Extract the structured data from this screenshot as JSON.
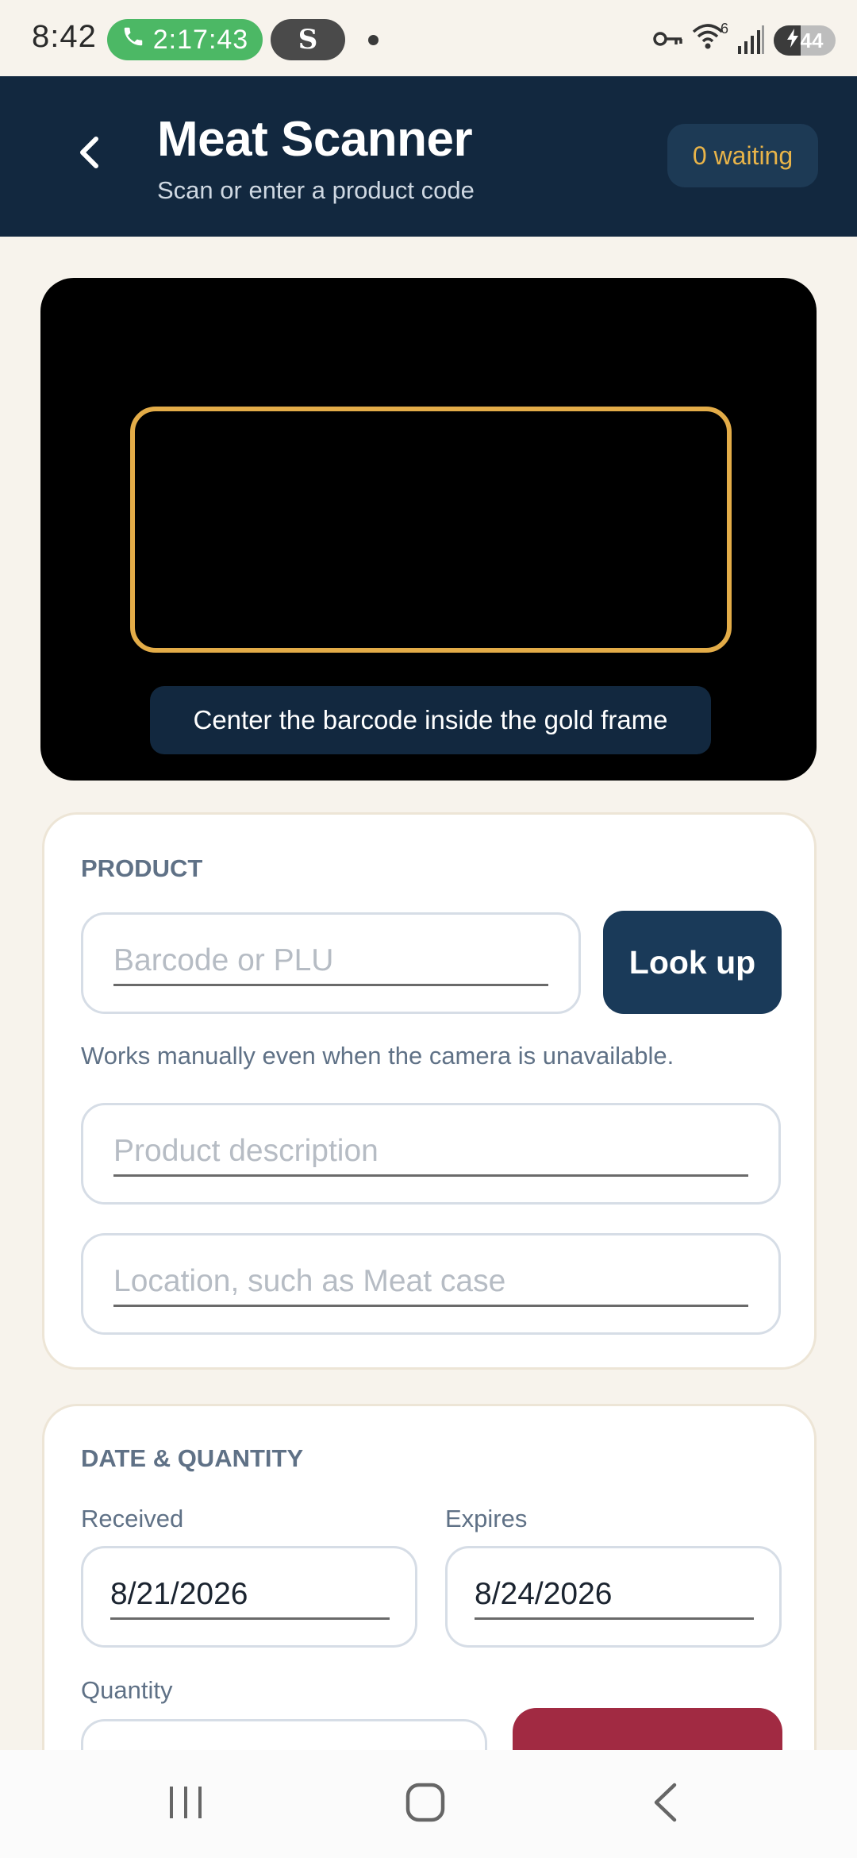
{
  "status_bar": {
    "time": "8:42",
    "call_timer": "2:17:43",
    "app_badge": "S",
    "wifi_label": "6",
    "battery_level": "44",
    "icons": [
      "phone-icon",
      "vpn-key-icon",
      "wifi-icon",
      "signal-icon",
      "battery-charging-icon"
    ]
  },
  "header": {
    "title": "Meat Scanner",
    "subtitle": "Scan or enter a product code",
    "waiting_badge": "0 waiting",
    "back_icon": "chevron-left-icon"
  },
  "camera": {
    "hint": "Center the barcode inside the gold frame"
  },
  "product": {
    "section_label": "PRODUCT",
    "barcode_placeholder": "Barcode or PLU",
    "barcode_value": "",
    "lookup_label": "Look up",
    "helper": "Works manually even when the camera is unavailable.",
    "description_placeholder": "Product description",
    "description_value": "",
    "location_placeholder": "Location, such as Meat case",
    "location_value": ""
  },
  "date_quantity": {
    "section_label": "DATE & QUANTITY",
    "received_label": "Received",
    "received_value": "8/21/2026",
    "expires_label": "Expires",
    "expires_value": "8/24/2026",
    "quantity_label": "Quantity",
    "quantity_value": ""
  },
  "nav": {
    "icons": [
      "recents-icon",
      "home-icon",
      "back-icon"
    ]
  },
  "colors": {
    "header_bg": "#12283f",
    "accent_gold": "#e3ac48",
    "button_navy": "#1a3a59",
    "button_red": "#a12a42",
    "page_bg": "#f7f3ec",
    "call_green": "#4cb865"
  }
}
